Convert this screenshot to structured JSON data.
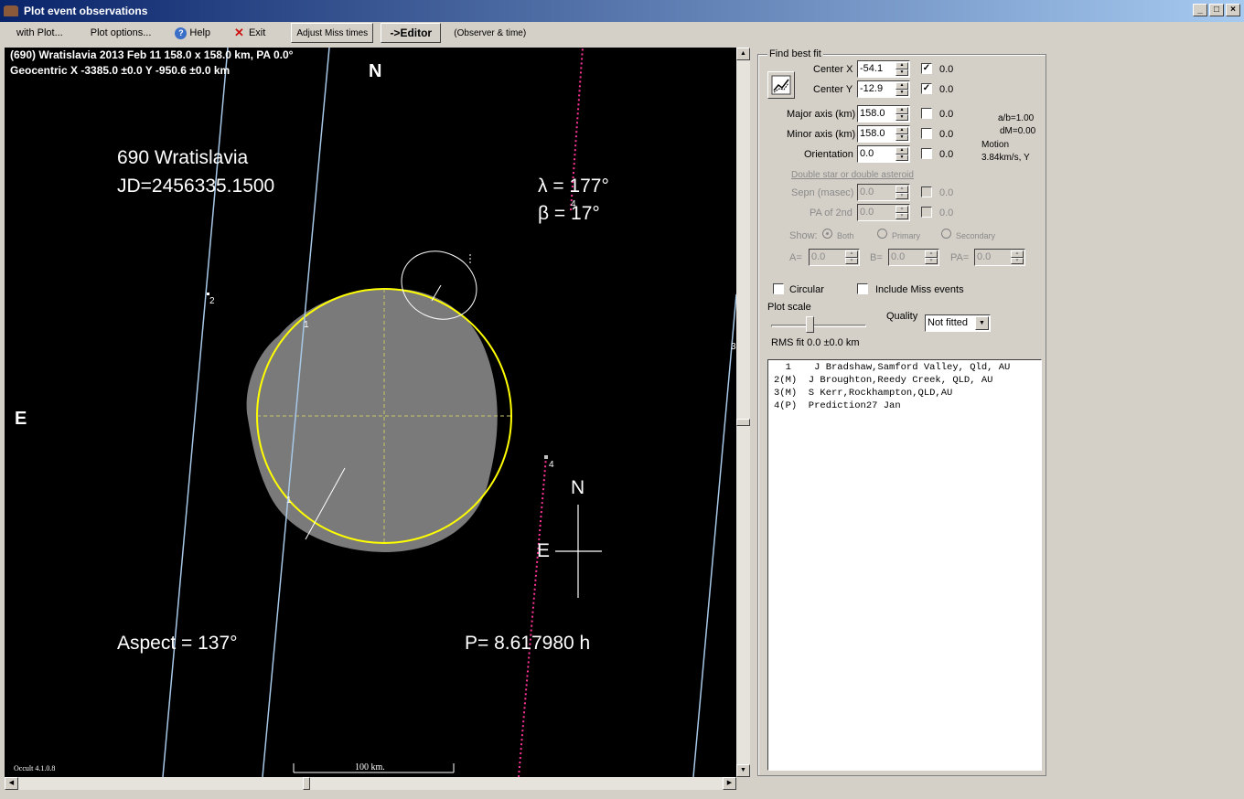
{
  "window": {
    "title": "Plot event observations",
    "buttons": {
      "minimize": "_",
      "maximize": "□",
      "close": "×"
    }
  },
  "menu": {
    "with_plot": "with Plot...",
    "plot_options": "Plot options...",
    "help": "Help",
    "exit": "Exit",
    "adjust_miss": "Adjust Miss times",
    "editor": "->Editor",
    "observer_time": "(Observer & time)"
  },
  "plot": {
    "header_line1": "(690) Wratislavia  2013 Feb 11  158.0 x 158.0 km, PA 0.0°",
    "header_line2": "Geocentric X -3385.0 ±0.0  Y -950.6 ±0.0 km",
    "north_top": "N",
    "east_left": "E",
    "asteroid_name": "690 Wratislavia",
    "jd": "JD=2456335.1500",
    "lambda": "λ =  177°",
    "beta": "β =   17°",
    "aspect": "Aspect = 137°",
    "period": "P= 8.617980 h",
    "compass_n": "N",
    "compass_e": "E",
    "chord_label_1a": "1",
    "chord_label_1b": "1",
    "chord_label_2": "2",
    "chord_label_3": "3",
    "chord_label_4a": "4",
    "chord_label_4b": "4",
    "scale_bar": "100 km.",
    "version": "Occult 4.1.0.8",
    "colors": {
      "ellipse": "#ffff00",
      "chord": "#a8c8e8",
      "prediction": "#ff3399",
      "model": "#808080"
    }
  },
  "fit": {
    "group_title": "Find best fit",
    "center_x": {
      "label": "Center X",
      "value": "-54.1",
      "checked": true,
      "uncert": "0.0"
    },
    "center_y": {
      "label": "Center Y",
      "value": "-12.9",
      "checked": true,
      "uncert": "0.0"
    },
    "major_axis": {
      "label": "Major axis (km)",
      "value": "158.0",
      "checked": false,
      "uncert": "0.0"
    },
    "minor_axis": {
      "label": "Minor axis (km)",
      "value": "158.0",
      "checked": false,
      "uncert": "0.0"
    },
    "orientation": {
      "label": "Orientation",
      "value": "0.0",
      "checked": false,
      "uncert": "0.0"
    },
    "ab_ratio": "a/b=1.00",
    "dm": "dM=0.00",
    "motion_label": "Motion",
    "motion_value": "3.84km/s, Y",
    "double_star_link": "Double star  or  double asteroid",
    "sepn": {
      "label": "Sepn (masec)",
      "value": "0.0",
      "uncert": "0.0"
    },
    "pa2": {
      "label": "PA of 2nd",
      "value": "0.0",
      "uncert": "0.0"
    },
    "show_label": "Show:",
    "show_both": "Both",
    "show_primary": "Primary",
    "show_secondary": "Secondary",
    "a_label": "A=",
    "a_value": "0.0",
    "b_label": "B=",
    "b_value": "0.0",
    "pa_label": "PA=",
    "pa_value": "0.0",
    "circular": "Circular",
    "include_miss": "Include Miss events",
    "plot_scale": "Plot scale",
    "quality_label": "Quality",
    "quality_value": "Not fitted",
    "rms": "RMS fit 0.0 ±0.0 km"
  },
  "observers": [
    "  1    J Bradshaw,Samford Valley, Qld, AU",
    "2(M)  J Broughton,Reedy Creek, QLD, AU",
    "3(M)  S Kerr,Rockhampton,QLD,AU",
    "4(P)  Prediction27 Jan"
  ]
}
